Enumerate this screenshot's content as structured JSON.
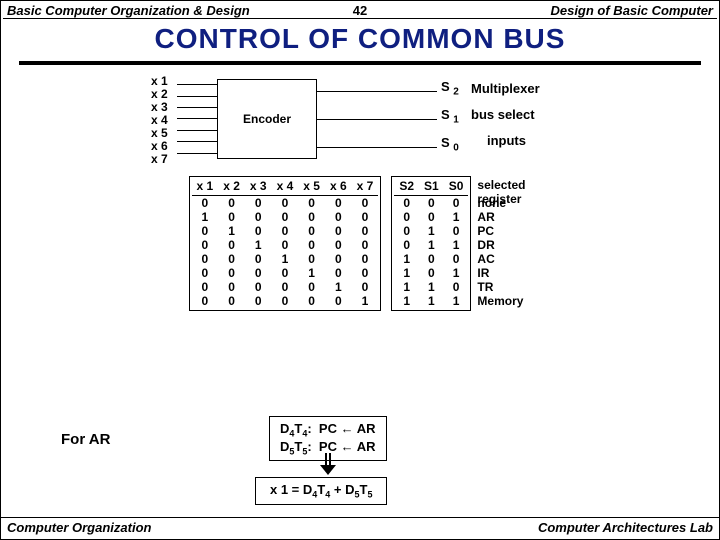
{
  "header": {
    "left": "Basic Computer Organization & Design",
    "page": "42",
    "right": "Design of Basic Computer"
  },
  "title": "CONTROL  OF  COMMON  BUS",
  "diagram": {
    "x_inputs": [
      "x 1",
      "x 2",
      "x 3",
      "x 4",
      "x 5",
      "x 6",
      "x 7"
    ],
    "encoder_label": "Encoder",
    "s_outputs": [
      "S",
      "S",
      "S"
    ],
    "s_subs": [
      "2",
      "1",
      "0"
    ],
    "right_labels": [
      "Multiplexer",
      "bus select",
      "inputs"
    ]
  },
  "truth_table": {
    "headers_x": [
      "x 1",
      "x 2",
      "x 3",
      "x 4",
      "x 5",
      "x 6",
      "x 7"
    ],
    "headers_s": [
      "S2",
      "S1",
      "S0"
    ],
    "rows_x": [
      [
        "0",
        "0",
        "0",
        "0",
        "0",
        "0",
        "0"
      ],
      [
        "1",
        "0",
        "0",
        "0",
        "0",
        "0",
        "0"
      ],
      [
        "0",
        "1",
        "0",
        "0",
        "0",
        "0",
        "0"
      ],
      [
        "0",
        "0",
        "1",
        "0",
        "0",
        "0",
        "0"
      ],
      [
        "0",
        "0",
        "0",
        "1",
        "0",
        "0",
        "0"
      ],
      [
        "0",
        "0",
        "0",
        "0",
        "1",
        "0",
        "0"
      ],
      [
        "0",
        "0",
        "0",
        "0",
        "0",
        "1",
        "0"
      ],
      [
        "0",
        "0",
        "0",
        "0",
        "0",
        "0",
        "1"
      ]
    ],
    "rows_s": [
      [
        "0",
        "0",
        "0"
      ],
      [
        "0",
        "0",
        "1"
      ],
      [
        "0",
        "1",
        "0"
      ],
      [
        "0",
        "1",
        "1"
      ],
      [
        "1",
        "0",
        "0"
      ],
      [
        "1",
        "0",
        "1"
      ],
      [
        "1",
        "1",
        "0"
      ],
      [
        "1",
        "1",
        "1"
      ]
    ],
    "sel_header": [
      "selected",
      "register"
    ],
    "sel_values": [
      "none",
      "AR",
      "PC",
      "DR",
      "AC",
      "IR",
      "TR",
      "Memory"
    ]
  },
  "for_ar": {
    "label": "For AR",
    "line1_pre": "D",
    "line1": "D4T4:  PC ← AR",
    "line2": "D5T5:  PC ← AR",
    "eq": "x 1 = D4T4 + D5T5"
  },
  "footer": {
    "left": "Computer Organization",
    "right": "Computer Architectures Lab"
  }
}
